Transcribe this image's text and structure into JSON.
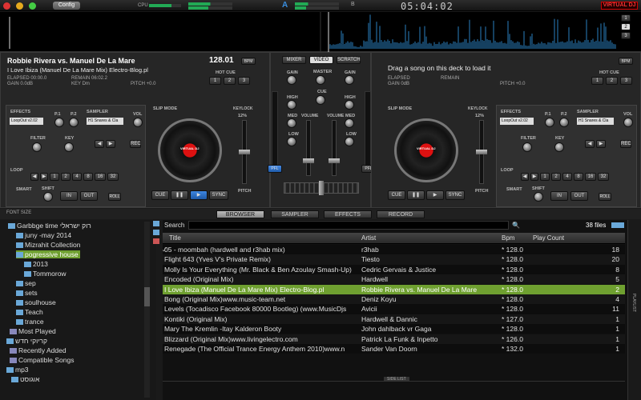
{
  "app": {
    "config_label": "Config",
    "cpu_label": "CPU",
    "clock": "05:04:02",
    "brand": "VIRTUAL DJ",
    "ab": [
      "A",
      "B"
    ],
    "zoom": [
      "1",
      "2",
      "3"
    ]
  },
  "deck_left": {
    "title": "Robbie Rivera vs. Manuel De La Mare",
    "subtitle": "I Love Ibiza (Manuel De La Mare Mix) Electro-Blog.pl",
    "bpm": "128.01",
    "bpm_label": "BPM",
    "elapsed": "ELAPSED 00:00.0",
    "remain": "REMAIN 06:02.2",
    "gain": "GAIN 0.0dB",
    "key": "KEY Dm",
    "pitch": "PITCH +0.0",
    "hot_cue": "HOT CUE",
    "hot": [
      "1",
      "2",
      "3"
    ],
    "effects": "EFFECTS",
    "effect_sel": "LoopOut v2.02",
    "p1": "P.1",
    "p2": "P.2",
    "sampler": "SAMPLER",
    "vol": "VOL",
    "sampler_sel": "H1 Snares & Cla",
    "filter": "FILTER",
    "key_lbl": "KEY",
    "rec": "REC",
    "loop": "LOOP",
    "loops": [
      "1",
      "2",
      "4",
      "8",
      "16",
      "32"
    ],
    "smart": "SMART",
    "shift": "SHIFT",
    "in": "IN",
    "out": "OUT",
    "roll": "ROLL",
    "slip": "SLIP MODE",
    "keylock": "KEYLOCK",
    "pct": "12%",
    "pitch_lbl": "PITCH",
    "cue": "CUE",
    "sync": "SYNC"
  },
  "deck_right": {
    "title": "Drag a song on this deck to load it",
    "elapsed": "ELAPSED",
    "remain": "REMAIN",
    "gain": "GAIN 0dB",
    "pitch": "PITCH +0.0",
    "bpm_label": "BPM",
    "hot_cue": "HOT CUE",
    "hot": [
      "1",
      "2",
      "3"
    ],
    "effects": "EFFECTS",
    "effect_sel": "LoopOut v2.02",
    "p1": "P.1",
    "p2": "P.2",
    "sampler": "SAMPLER",
    "vol": "VOL",
    "sampler_sel": "H1 Snares & Cla",
    "filter": "FILTER",
    "key_lbl": "KEY",
    "rec": "REC",
    "loop": "LOOP",
    "loops": [
      "1",
      "2",
      "4",
      "8",
      "16",
      "32"
    ],
    "smart": "SMART",
    "shift": "SHIFT",
    "in": "IN",
    "out": "OUT",
    "roll": "ROLL",
    "slip": "SLIP MODE",
    "keylock": "KEYLOCK",
    "pct": "12%",
    "pitch_lbl": "PITCH",
    "cue": "CUE",
    "sync": "SYNC"
  },
  "mixer": {
    "tabs": [
      "MIXER",
      "VIDEO",
      "SCRATCH"
    ],
    "gain": "GAIN",
    "master": "MASTER",
    "cue": "CUE",
    "high": "HIGH",
    "med": "MED",
    "low": "LOW",
    "volume": "VOLUME",
    "pfl": "PFL"
  },
  "browser": {
    "font_size": "FONT SIZE",
    "tabs": [
      "BROWSER",
      "SAMPLER",
      "EFFECTS",
      "RECORD"
    ],
    "search_label": "Search",
    "file_count": "38 files",
    "side_list": "SIDE LIST",
    "playlist": "PLAYLIST",
    "tree": [
      "Garbbge time רוק ישראלי",
      "juny -may 2014",
      "Mizrahit Collection",
      "pogressive house",
      "2013",
      "Tommorow",
      "sep",
      "sets",
      "soulhouse",
      "Teach",
      "trance",
      "Most Played",
      "קריוקי חדש",
      "Recently Added",
      "Compatible Songs",
      "mp3",
      "אוגוסט"
    ],
    "columns": [
      "Title",
      "Artist",
      "Bpm",
      "Play Count"
    ],
    "rows": [
      [
        "05 - moombah (hardwell and r3hab mix)",
        "r3hab",
        "* 128.0",
        "18"
      ],
      [
        "Flight 643 (Yves V's Private Remix)",
        "Tiesto",
        "* 128.0",
        "20"
      ],
      [
        "Molly Is Your Everything (Mr. Black & Ben Azoulay Smash-Up)",
        "Cedric Gervais & Justice",
        "* 128.0",
        "8"
      ],
      [
        "Encoded (Original Mix)",
        "Hardwell",
        "* 128.0",
        "5"
      ],
      [
        "I Love Ibiza (Manuel De La Mare Mix) Electro-Blog.pl",
        "Robbie Rivera vs. Manuel De La Mare",
        "* 128.0",
        "2"
      ],
      [
        "Bong (Original Mix)www.music-team.net",
        "Deniz Koyu",
        "* 128.0",
        "4"
      ],
      [
        "Levels (Tocadisco Facebook 80000 Bootleg) (www.MusicDjs",
        "Avicii",
        "* 128.0",
        "11"
      ],
      [
        "Kontiki (Original Mix)",
        "Hardwell & Dannic",
        "* 127.0",
        "1"
      ],
      [
        "Mary The Kremlin -Itay Kalderon Booty",
        "John dahlback vr Gaga",
        "* 128.0",
        "1"
      ],
      [
        "Blizzard (Original Mix)www.livingelectro.com",
        "Patrick La Funk & Inpetto",
        "* 126.0",
        "1"
      ],
      [
        "Renegade (The Official Trance Energy Anthem 2010)www.n",
        "Sander Van Doorn",
        "* 132.0",
        "1"
      ]
    ]
  },
  "colors": {
    "accent_blue": "#1e5aa8",
    "wave": "#2a7fc0",
    "selected_row": "#6fa030",
    "folder": "#6aa8d8"
  }
}
